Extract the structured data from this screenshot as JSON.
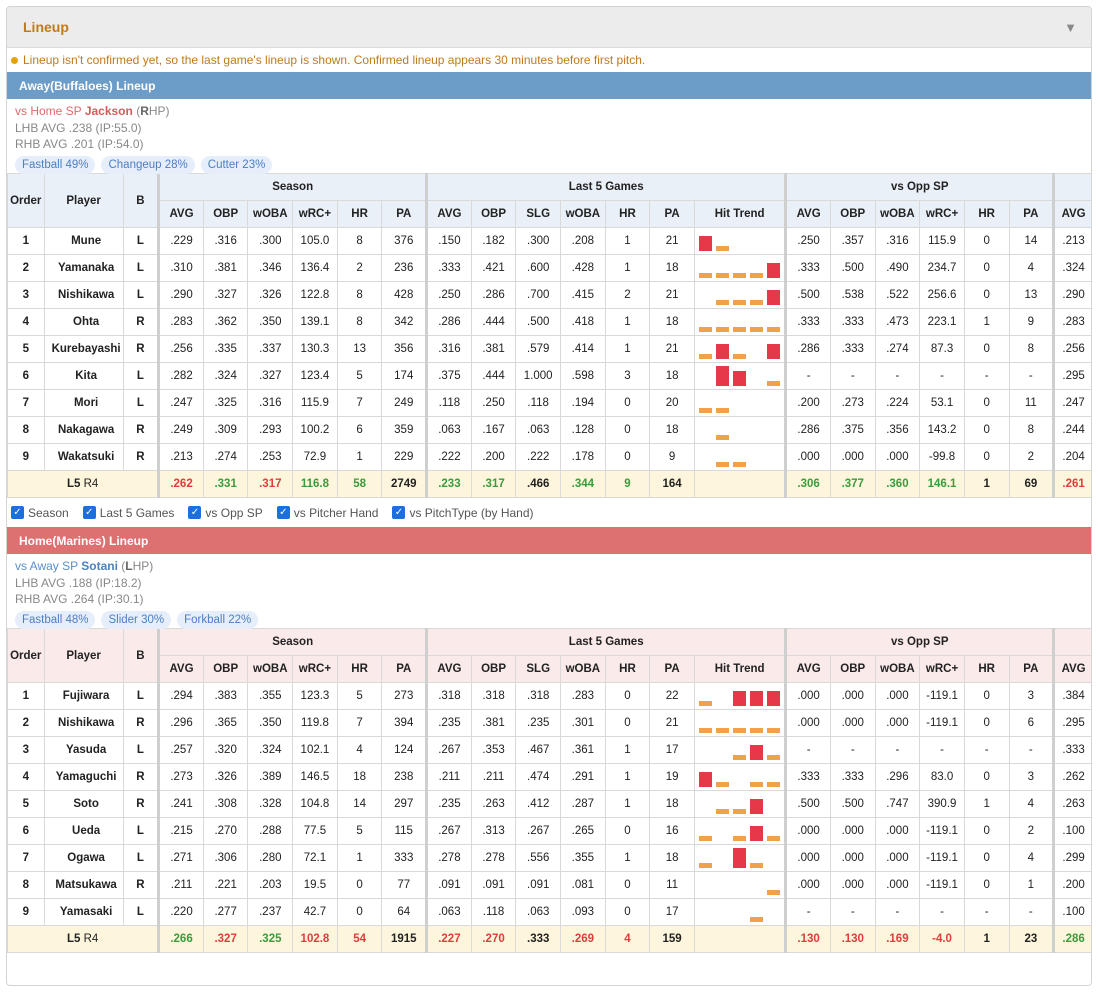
{
  "panel": {
    "title": "Lineup",
    "collapse_icon": "triangle-down-icon"
  },
  "notice": "Lineup isn't confirmed yet, so the last game's lineup is shown. Confirmed lineup appears 30 minutes before first pitch.",
  "headers": {
    "order": "Order",
    "player": "Player",
    "b": "B",
    "groups": [
      "Season",
      "Last 5 Games",
      "vs Opp SP"
    ],
    "season_cols": [
      "AVG",
      "OBP",
      "wOBA",
      "wRC+",
      "HR",
      "PA"
    ],
    "l5_cols": [
      "AVG",
      "OBP",
      "SLG",
      "wOBA",
      "HR",
      "PA",
      "Hit Trend"
    ],
    "sp_cols": [
      "AVG",
      "OBP",
      "wOBA",
      "wRC+",
      "HR",
      "PA"
    ],
    "extra_col": "AVG"
  },
  "colors": {
    "trend_hit": "#e5394a",
    "trend_out": "#f0a24a",
    "away_bar": "#6c9cc8",
    "home_bar": "#dd7070"
  },
  "toggles": [
    {
      "label": "Season",
      "checked": true
    },
    {
      "label": "Last 5 Games",
      "checked": true
    },
    {
      "label": "vs Opp SP",
      "checked": true
    },
    {
      "label": "vs Pitcher Hand",
      "checked": true
    },
    {
      "label": "vs PitchType (by Hand)",
      "checked": true
    }
  ],
  "away": {
    "title": "Away(Buffaloes) Lineup",
    "vs_label": "vs Home SP",
    "sp_name": "Jackson",
    "sp_hand_open": "(",
    "sp_hand_letter": "R",
    "sp_hand_rest": "HP)",
    "lhb": "LHB AVG .238 (IP:55.0)",
    "rhb": "RHB AVG .201 (IP:54.0)",
    "pitch_tags": [
      "Fastball 49%",
      "Changeup 28%",
      "Cutter 23%"
    ],
    "rows": [
      {
        "order": "1",
        "player": "Mune",
        "b": "L",
        "season": [
          ".229",
          ".316",
          ".300",
          "105.0",
          "8",
          "376"
        ],
        "l5": [
          ".150",
          ".182",
          ".300",
          ".208",
          "1",
          "21"
        ],
        "trend": [
          2,
          1,
          0,
          0,
          0
        ],
        "sp": [
          ".250",
          ".357",
          ".316",
          "115.9",
          "0",
          "14"
        ],
        "extra": ".213"
      },
      {
        "order": "2",
        "player": "Yamanaka",
        "b": "L",
        "season": [
          ".310",
          ".381",
          ".346",
          "136.4",
          "2",
          "236"
        ],
        "l5": [
          ".333",
          ".421",
          ".600",
          ".428",
          "1",
          "18"
        ],
        "trend": [
          1,
          1,
          1,
          1,
          2
        ],
        "sp": [
          ".333",
          ".500",
          ".490",
          "234.7",
          "0",
          "4"
        ],
        "extra": ".324"
      },
      {
        "order": "3",
        "player": "Nishikawa",
        "b": "L",
        "season": [
          ".290",
          ".327",
          ".326",
          "122.8",
          "8",
          "428"
        ],
        "l5": [
          ".250",
          ".286",
          ".700",
          ".415",
          "2",
          "21"
        ],
        "trend": [
          0,
          1,
          1,
          1,
          2
        ],
        "sp": [
          ".500",
          ".538",
          ".522",
          "256.6",
          "0",
          "13"
        ],
        "extra": ".290"
      },
      {
        "order": "4",
        "player": "Ohta",
        "b": "R",
        "season": [
          ".283",
          ".362",
          ".350",
          "139.1",
          "8",
          "342"
        ],
        "l5": [
          ".286",
          ".444",
          ".500",
          ".418",
          "1",
          "18"
        ],
        "trend": [
          1,
          1,
          1,
          1,
          1
        ],
        "sp": [
          ".333",
          ".333",
          ".473",
          "223.1",
          "1",
          "9"
        ],
        "extra": ".283"
      },
      {
        "order": "5",
        "player": "Kurebayashi",
        "b": "R",
        "season": [
          ".256",
          ".335",
          ".337",
          "130.3",
          "13",
          "356"
        ],
        "l5": [
          ".316",
          ".381",
          ".579",
          ".414",
          "1",
          "21"
        ],
        "trend": [
          1,
          2,
          1,
          0,
          2
        ],
        "sp": [
          ".286",
          ".333",
          ".274",
          "87.3",
          "0",
          "8"
        ],
        "extra": ".256"
      },
      {
        "order": "6",
        "player": "Kita",
        "b": "L",
        "season": [
          ".282",
          ".324",
          ".327",
          "123.4",
          "5",
          "174"
        ],
        "l5": [
          ".375",
          ".444",
          "1.000",
          ".598",
          "3",
          "18"
        ],
        "trend": [
          0,
          3,
          2,
          0,
          1
        ],
        "sp": [
          "-",
          "-",
          "-",
          "-",
          "-",
          "-"
        ],
        "extra": ".295"
      },
      {
        "order": "7",
        "player": "Mori",
        "b": "L",
        "season": [
          ".247",
          ".325",
          ".316",
          "115.9",
          "7",
          "249"
        ],
        "l5": [
          ".118",
          ".250",
          ".118",
          ".194",
          "0",
          "20"
        ],
        "trend": [
          1,
          1,
          0,
          0,
          0
        ],
        "sp": [
          ".200",
          ".273",
          ".224",
          "53.1",
          "0",
          "11"
        ],
        "extra": ".247"
      },
      {
        "order": "8",
        "player": "Nakagawa",
        "b": "R",
        "season": [
          ".249",
          ".309",
          ".293",
          "100.2",
          "6",
          "359"
        ],
        "l5": [
          ".063",
          ".167",
          ".063",
          ".128",
          "0",
          "18"
        ],
        "trend": [
          0,
          1,
          0,
          0,
          0
        ],
        "sp": [
          ".286",
          ".375",
          ".356",
          "143.2",
          "0",
          "8"
        ],
        "extra": ".244"
      },
      {
        "order": "9",
        "player": "Wakatsuki",
        "b": "R",
        "season": [
          ".213",
          ".274",
          ".253",
          "72.9",
          "1",
          "229"
        ],
        "l5": [
          ".222",
          ".200",
          ".222",
          ".178",
          "0",
          "9"
        ],
        "trend": [
          0,
          1,
          1,
          0,
          0
        ],
        "sp": [
          ".000",
          ".000",
          ".000",
          "-99.8",
          "0",
          "2"
        ],
        "extra": ".204"
      }
    ],
    "summary": {
      "label_main": "L5",
      "label_sub": "R4",
      "season": [
        ".262",
        ".331",
        ".317",
        "116.8",
        "58",
        "2749"
      ],
      "l5": [
        ".233",
        ".317",
        ".466",
        ".344",
        "9",
        "164"
      ],
      "sp": [
        ".306",
        ".377",
        ".360",
        "146.1",
        "1",
        "69"
      ],
      "extra": ".261"
    }
  },
  "home": {
    "title": "Home(Marines) Lineup",
    "vs_label": "vs Away SP",
    "sp_name": "Sotani",
    "sp_hand_open": "(",
    "sp_hand_letter": "L",
    "sp_hand_rest": "HP)",
    "lhb": "LHB AVG .188 (IP:18.2)",
    "rhb": "RHB AVG .264 (IP:30.1)",
    "pitch_tags": [
      "Fastball 48%",
      "Slider 30%",
      "Forkball 22%"
    ],
    "rows": [
      {
        "order": "1",
        "player": "Fujiwara",
        "b": "L",
        "season": [
          ".294",
          ".383",
          ".355",
          "123.3",
          "5",
          "273"
        ],
        "l5": [
          ".318",
          ".318",
          ".318",
          ".283",
          "0",
          "22"
        ],
        "trend": [
          1,
          0,
          2,
          2,
          2
        ],
        "sp": [
          ".000",
          ".000",
          ".000",
          "-119.1",
          "0",
          "3"
        ],
        "extra": ".384"
      },
      {
        "order": "2",
        "player": "Nishikawa",
        "b": "R",
        "season": [
          ".296",
          ".365",
          ".350",
          "119.8",
          "7",
          "394"
        ],
        "l5": [
          ".235",
          ".381",
          ".235",
          ".301",
          "0",
          "21"
        ],
        "trend": [
          1,
          1,
          1,
          1,
          1
        ],
        "sp": [
          ".000",
          ".000",
          ".000",
          "-119.1",
          "0",
          "6"
        ],
        "extra": ".295"
      },
      {
        "order": "3",
        "player": "Yasuda",
        "b": "L",
        "season": [
          ".257",
          ".320",
          ".324",
          "102.1",
          "4",
          "124"
        ],
        "l5": [
          ".267",
          ".353",
          ".467",
          ".361",
          "1",
          "17"
        ],
        "trend": [
          0,
          0,
          1,
          2,
          1
        ],
        "sp": [
          "-",
          "-",
          "-",
          "-",
          "-",
          "-"
        ],
        "extra": ".333"
      },
      {
        "order": "4",
        "player": "Yamaguchi",
        "b": "R",
        "season": [
          ".273",
          ".326",
          ".389",
          "146.5",
          "18",
          "238"
        ],
        "l5": [
          ".211",
          ".211",
          ".474",
          ".291",
          "1",
          "19"
        ],
        "trend": [
          2,
          1,
          0,
          1,
          1
        ],
        "sp": [
          ".333",
          ".333",
          ".296",
          "83.0",
          "0",
          "3"
        ],
        "extra": ".262"
      },
      {
        "order": "5",
        "player": "Soto",
        "b": "R",
        "season": [
          ".241",
          ".308",
          ".328",
          "104.8",
          "14",
          "297"
        ],
        "l5": [
          ".235",
          ".263",
          ".412",
          ".287",
          "1",
          "18"
        ],
        "trend": [
          0,
          1,
          1,
          2,
          0
        ],
        "sp": [
          ".500",
          ".500",
          ".747",
          "390.9",
          "1",
          "4"
        ],
        "extra": ".263"
      },
      {
        "order": "6",
        "player": "Ueda",
        "b": "L",
        "season": [
          ".215",
          ".270",
          ".288",
          "77.5",
          "5",
          "115"
        ],
        "l5": [
          ".267",
          ".313",
          ".267",
          ".265",
          "0",
          "16"
        ],
        "trend": [
          1,
          0,
          1,
          2,
          1
        ],
        "sp": [
          ".000",
          ".000",
          ".000",
          "-119.1",
          "0",
          "2"
        ],
        "extra": ".100"
      },
      {
        "order": "7",
        "player": "Ogawa",
        "b": "L",
        "season": [
          ".271",
          ".306",
          ".280",
          "72.1",
          "1",
          "333"
        ],
        "l5": [
          ".278",
          ".278",
          ".556",
          ".355",
          "1",
          "18"
        ],
        "trend": [
          1,
          0,
          3,
          1,
          0
        ],
        "sp": [
          ".000",
          ".000",
          ".000",
          "-119.1",
          "0",
          "4"
        ],
        "extra": ".299"
      },
      {
        "order": "8",
        "player": "Matsukawa",
        "b": "R",
        "season": [
          ".211",
          ".221",
          ".203",
          "19.5",
          "0",
          "77"
        ],
        "l5": [
          ".091",
          ".091",
          ".091",
          ".081",
          "0",
          "11"
        ],
        "trend": [
          0,
          0,
          0,
          0,
          1
        ],
        "sp": [
          ".000",
          ".000",
          ".000",
          "-119.1",
          "0",
          "1"
        ],
        "extra": ".200"
      },
      {
        "order": "9",
        "player": "Yamasaki",
        "b": "L",
        "season": [
          ".220",
          ".277",
          ".237",
          "42.7",
          "0",
          "64"
        ],
        "l5": [
          ".063",
          ".118",
          ".063",
          ".093",
          "0",
          "17"
        ],
        "trend": [
          0,
          0,
          0,
          1,
          0
        ],
        "sp": [
          "-",
          "-",
          "-",
          "-",
          "-",
          "-"
        ],
        "extra": ".100"
      }
    ],
    "summary": {
      "label_main": "L5",
      "label_sub": "R4",
      "season": [
        ".266",
        ".327",
        ".325",
        "102.8",
        "54",
        "1915"
      ],
      "l5": [
        ".227",
        ".270",
        ".333",
        ".269",
        "4",
        "159"
      ],
      "sp": [
        ".130",
        ".130",
        ".169",
        "-4.0",
        "1",
        "23"
      ],
      "extra": ".286"
    },
    "summary_colors": {
      "season": [
        "green",
        "red",
        "green",
        "red",
        "red",
        "black"
      ],
      "l5": [
        "red",
        "red",
        "black",
        "red",
        "red",
        "black"
      ],
      "sp": [
        "red",
        "red",
        "red",
        "red",
        "black",
        "black"
      ],
      "extra": "green"
    }
  },
  "away_summary_colors": {
    "season": [
      "red",
      "green",
      "red",
      "green",
      "green",
      "black"
    ],
    "l5": [
      "green",
      "green",
      "black",
      "green",
      "green",
      "black"
    ],
    "sp": [
      "green",
      "green",
      "green",
      "green",
      "black",
      "black"
    ],
    "extra": "red"
  }
}
